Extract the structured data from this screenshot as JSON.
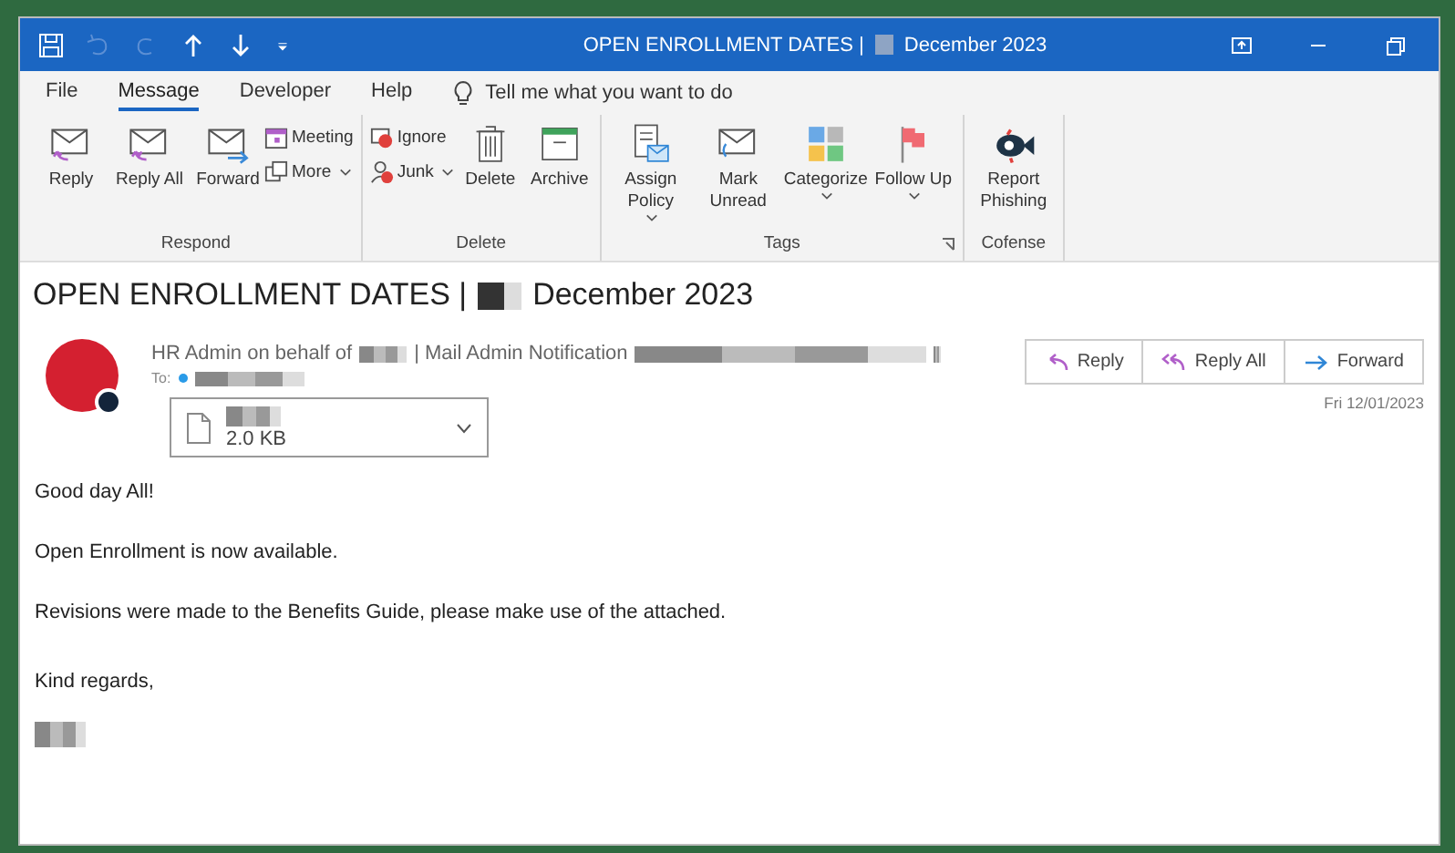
{
  "window": {
    "title_before": "OPEN ENROLLMENT DATES |",
    "title_after": "December 2023"
  },
  "menu": {
    "tabs": [
      {
        "label": "File",
        "selected": false
      },
      {
        "label": "Message",
        "selected": true
      },
      {
        "label": "Developer",
        "selected": false
      },
      {
        "label": "Help",
        "selected": false
      }
    ],
    "tell_me": "Tell me what you want to do"
  },
  "ribbon": {
    "groups": [
      {
        "name": "Respond",
        "launcher": false,
        "items": [
          {
            "kind": "large",
            "label": "Reply",
            "dropdown": false
          },
          {
            "kind": "large",
            "label": "Reply All",
            "dropdown": false
          },
          {
            "kind": "large",
            "label": "Forward",
            "dropdown": false
          },
          {
            "kind": "small",
            "label": "Meeting",
            "dropdown": false
          },
          {
            "kind": "small",
            "label": "More",
            "dropdown": true
          }
        ]
      },
      {
        "name": "Delete",
        "launcher": false,
        "items": [
          {
            "kind": "small",
            "label": "Ignore",
            "dropdown": false
          },
          {
            "kind": "small",
            "label": "Junk",
            "dropdown": true
          },
          {
            "kind": "large",
            "label": "Delete",
            "dropdown": false
          },
          {
            "kind": "large",
            "label": "Archive",
            "dropdown": false
          }
        ]
      },
      {
        "name": "Tags",
        "launcher": true,
        "items": [
          {
            "kind": "large",
            "label": "Assign Policy",
            "dropdown": true
          },
          {
            "kind": "large",
            "label": "Mark Unread",
            "dropdown": false
          },
          {
            "kind": "large",
            "label": "Categorize",
            "dropdown": true
          },
          {
            "kind": "large",
            "label": "Follow Up",
            "dropdown": true
          }
        ]
      },
      {
        "name": "Cofense",
        "launcher": false,
        "items": [
          {
            "kind": "large",
            "label": "Report Phishing",
            "dropdown": false
          }
        ]
      }
    ]
  },
  "message": {
    "subject_before": "OPEN ENROLLMENT DATES |",
    "subject_after": "December 2023",
    "sender_before": "HR Admin on behalf of",
    "sender_after": "| Mail Admin Notification",
    "to_label": "To:",
    "actions": [
      "Reply",
      "Reply All",
      "Forward"
    ],
    "date": "Fri 12/01/2023",
    "attachment": {
      "size": "2.0 KB"
    },
    "body": [
      "Good day All!",
      "Open Enrollment is now available.",
      "Revisions were made to the Benefits Guide, please make use of the attached."
    ],
    "closing": "Kind regards,"
  }
}
